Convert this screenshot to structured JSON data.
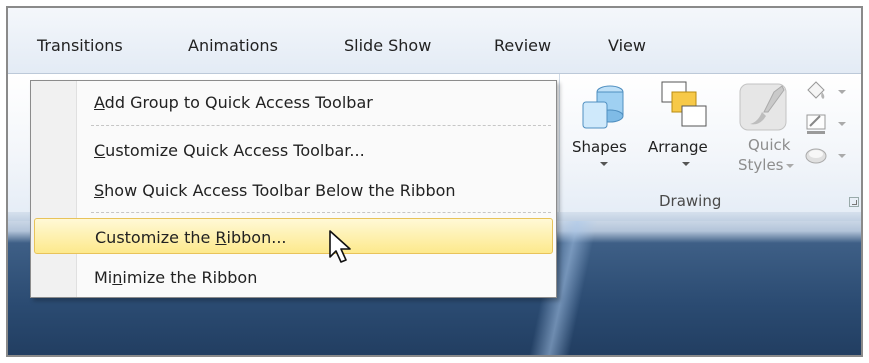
{
  "ribbon": {
    "tabs": [
      "Transitions",
      "Animations",
      "Slide Show",
      "Review",
      "View"
    ],
    "drawing_group": {
      "label": "Drawing",
      "shapes_label": "Shapes",
      "arrange_label": "Arrange",
      "quick_styles_line1": "Quick",
      "quick_styles_line2": "Styles"
    }
  },
  "context_menu": {
    "items": [
      {
        "pre": "",
        "key": "A",
        "post": "dd Group to Quick Access Toolbar"
      },
      {
        "pre": "",
        "key": "C",
        "post": "ustomize Quick Access Toolbar..."
      },
      {
        "pre": "",
        "key": "S",
        "post": "how Quick Access Toolbar Below the Ribbon"
      },
      {
        "pre": "Customize the ",
        "key": "R",
        "post": "ibbon..."
      },
      {
        "pre": "Mi",
        "key": "n",
        "post": "imize the Ribbon"
      }
    ]
  },
  "colors": {
    "highlight_top": "#fff9d6",
    "highlight_bottom": "#fde98c",
    "highlight_border": "#e8c35a",
    "slide_background": "#2b4b72"
  },
  "icons": [
    "shapes-icon",
    "arrange-icon",
    "quick-styles-icon",
    "shape-fill-icon",
    "shape-outline-icon",
    "shape-effects-icon",
    "dialog-launcher-icon",
    "mouse-cursor-icon"
  ]
}
